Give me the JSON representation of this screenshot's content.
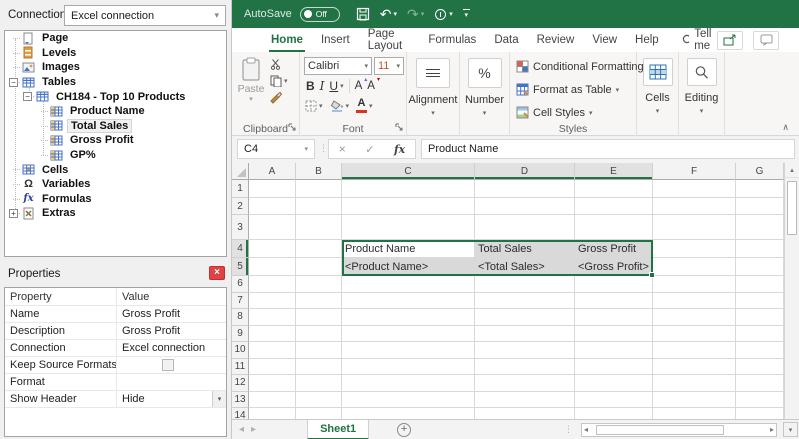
{
  "colors": {
    "excel_green": "#217346",
    "selection_fill": "#d9d9d9",
    "font_color_red": "#e0301e",
    "close_button_red": "#e04343"
  },
  "left_panel": {
    "connection": {
      "label": "Connection",
      "value": "Excel connection"
    },
    "tree": {
      "items": [
        {
          "label": "Page"
        },
        {
          "label": "Levels"
        },
        {
          "label": "Images"
        },
        {
          "label": "Tables"
        },
        {
          "label": "CH184 - Top 10 Products"
        },
        {
          "label": "Product Name"
        },
        {
          "label": "Total Sales"
        },
        {
          "label": "Gross Profit"
        },
        {
          "label": "GP%"
        },
        {
          "label": "Cells"
        },
        {
          "label": "Variables"
        },
        {
          "label": "Formulas"
        },
        {
          "label": "Extras"
        }
      ]
    },
    "properties": {
      "title": "Properties",
      "columns": [
        "Property",
        "Value"
      ],
      "rows": [
        {
          "property": "Name",
          "value": "Gross Profit"
        },
        {
          "property": "Description",
          "value": "Gross Profit"
        },
        {
          "property": "Connection",
          "value": "Excel connection"
        },
        {
          "property": "Keep Source Formats",
          "value": ""
        },
        {
          "property": "Format",
          "value": ""
        },
        {
          "property": "Show Header",
          "value": "Hide"
        }
      ]
    }
  },
  "excel": {
    "titlebar": {
      "autosave_label": "AutoSave",
      "autosave_state": "Off"
    },
    "tabs": [
      "Home",
      "Insert",
      "Page Layout",
      "Formulas",
      "Data",
      "Review",
      "View",
      "Help"
    ],
    "tell_me": "Tell me",
    "ribbon": {
      "clipboard": {
        "label": "Clipboard",
        "paste": "Paste"
      },
      "font": {
        "label": "Font",
        "name": "Calibri",
        "size": "11",
        "bold": "B",
        "italic": "I",
        "underline": "U",
        "grow": "A",
        "shrink": "A"
      },
      "alignment": {
        "label": "Alignment"
      },
      "number": {
        "label": "Number",
        "symbol": "%"
      },
      "styles": {
        "label": "Styles",
        "items": [
          "Conditional Formatting",
          "Format as Table",
          "Cell Styles"
        ]
      },
      "cells": {
        "label": "Cells"
      },
      "editing": {
        "label": "Editing"
      }
    },
    "formula_bar": {
      "name_box": "C4",
      "fx": "fx",
      "value": "Product Name"
    },
    "grid": {
      "column_headers": [
        "A",
        "B",
        "C",
        "D",
        "E",
        "F",
        "G"
      ],
      "row_headers": [
        "1",
        "2",
        "3",
        "4",
        "5",
        "6",
        "7",
        "8",
        "9",
        "10",
        "11",
        "12",
        "13",
        "14"
      ],
      "cells": {
        "C4": "Product Name",
        "D4": "Total Sales",
        "E4": "Gross Profit",
        "C5": "<Product Name>",
        "D5": "<Total Sales>",
        "E5": "<Gross Profit>"
      }
    },
    "sheet_bar": {
      "sheet_name": "Sheet1"
    }
  }
}
